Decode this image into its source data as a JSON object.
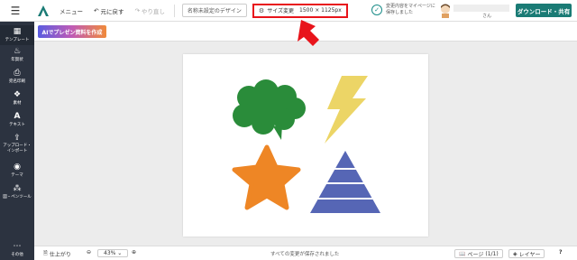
{
  "topbar": {
    "menu_label": "メニュー",
    "undo_label": "元に戻す",
    "redo_label": "やり直し",
    "design_name": "名称未設定のデザイン",
    "size_label": "サイズ変更",
    "size_value": "1500 × 1125px",
    "save_status_line1": "変更内容をマイページに",
    "save_status_line2": "保存しました",
    "username_suffix": "さん",
    "download_label": "ダウンロード・共有"
  },
  "sidebar": {
    "items": [
      {
        "label": "テンプレート",
        "icon": "template-icon"
      },
      {
        "label": "年賀状",
        "icon": "new-year-icon"
      },
      {
        "label": "宛名印刷",
        "icon": "printer-icon"
      },
      {
        "label": "素材",
        "icon": "material-icon"
      },
      {
        "label": "テキスト",
        "icon": "text-icon"
      },
      {
        "label": "アップロード・インポート",
        "icon": "upload-icon"
      },
      {
        "label": "テーマ",
        "icon": "theme-icon"
      },
      {
        "label": "図・ペンツール",
        "icon": "pen-tool-icon"
      },
      {
        "label": "その他",
        "icon": "more-icon"
      }
    ]
  },
  "subbar": {
    "ai_button_label": "AIでプレゼン資料を作成"
  },
  "canvas": {
    "shapes": [
      {
        "name": "speech-bubble",
        "color": "#2a8c3a"
      },
      {
        "name": "lightning-bolt",
        "color": "#ecd566"
      },
      {
        "name": "star",
        "color": "#ee8625"
      },
      {
        "name": "pyramid",
        "color": "#5666b5"
      }
    ]
  },
  "bottombar": {
    "finish_label": "仕上がり",
    "zoom_value": "43%",
    "status_text": "すべての変更が保存されました",
    "page_label": "ページ",
    "page_count": "(1/1)",
    "layer_label": "レイヤー",
    "help_label": "?"
  },
  "colors": {
    "accent": "#1a7b75",
    "sidebar_bg": "#2c3340",
    "highlight": "#e8141b"
  }
}
